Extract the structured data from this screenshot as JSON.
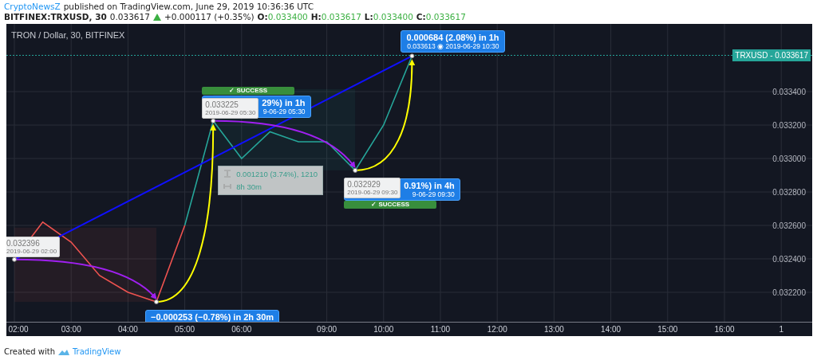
{
  "header": {
    "author": "CryptoNewsZ",
    "published": "published on TradingView.com, June 29, 2019 10:36:36 UTC",
    "symbol": "BITFINEX:TRXUSD, 30",
    "last": "0.033617",
    "change": "+0.000117 (+0.35%)",
    "ohlc": [
      {
        "label": "O:",
        "value": "0.033400"
      },
      {
        "label": "H:",
        "value": "0.033617"
      },
      {
        "label": "L:",
        "value": "0.033400"
      },
      {
        "label": "C:",
        "value": "0.033617"
      }
    ]
  },
  "chart": {
    "title": "TRON / Dollar, 30, BITFINEX",
    "price_label": "TRXUSD - 0.033617",
    "chart_data": {
      "type": "line",
      "categories": [
        "02:00",
        null,
        "03:00",
        null,
        "04:00",
        null,
        "05:00",
        null,
        "06:00",
        null,
        null,
        "09:00",
        null,
        "10:00",
        null,
        "11:00",
        null,
        "12:00",
        null,
        "13:00",
        null,
        "14:00",
        null,
        "15:00",
        null,
        "16:00",
        null,
        "1"
      ],
      "series": [
        {
          "color": "#ef5350",
          "values": [
            0.032396,
            0.03262,
            0.0325,
            0.0323,
            0.0322,
            0.032143,
            0.0326,
            null,
            null,
            null,
            null,
            null,
            null,
            null,
            null,
            null,
            null,
            null,
            null,
            null,
            null,
            null,
            null,
            null,
            null,
            null,
            null,
            null
          ]
        },
        {
          "color": "#26a69a",
          "values": [
            null,
            null,
            null,
            null,
            null,
            null,
            0.0326,
            0.033225,
            0.033,
            0.03316,
            0.0331,
            0.0331,
            0.032929,
            0.0332,
            0.033613,
            null,
            null,
            null,
            null,
            null,
            null,
            null,
            null,
            null,
            null,
            null,
            null,
            null
          ]
        }
      ],
      "ylim": [
        0.032019,
        0.033805
      ],
      "grid": true,
      "ref_lines": [
        {
          "axis": "y",
          "value": 0.033617,
          "color": "#26a69a"
        }
      ],
      "yticks": [
        {
          "value": 0.0334,
          "label": "0.033400"
        },
        {
          "value": 0.0332,
          "label": "0.033200"
        },
        {
          "value": 0.033,
          "label": "0.033000"
        },
        {
          "value": 0.0328,
          "label": "0.032800"
        },
        {
          "value": 0.0326,
          "label": "0.032600"
        },
        {
          "value": 0.0324,
          "label": "0.032400"
        },
        {
          "value": 0.0322,
          "label": "0.032200"
        }
      ]
    },
    "labels": [
      {
        "kind": "gain",
        "covered": false,
        "text": "0.000684 (2.08%) in 1h",
        "detail": "0.033613  ◉  2019-06-29  10:30"
      },
      {
        "kind": "success",
        "text": "✓ SUCCESS"
      },
      {
        "kind": "point",
        "text": "0.033225",
        "detail": "2019-06-29 05:30"
      },
      {
        "kind": "gain",
        "covered": true,
        "text": "29%) in 1h",
        "detail": "9-06-29  05:30"
      },
      {
        "kind": "measure",
        "text": "0.001210 (3.74%), 1210",
        "detail": "8h 30m"
      },
      {
        "kind": "point",
        "text": "0.032929",
        "detail": "2019-06-29 09:30"
      },
      {
        "kind": "gain",
        "covered": true,
        "text": "0.91%) in 4h",
        "detail": "9-06-29  09:30"
      },
      {
        "kind": "success",
        "text": "✓ SUCCESS"
      },
      {
        "kind": "point",
        "text": "0.032396",
        "detail": "2019-06-29 02:00"
      },
      {
        "kind": "gain",
        "covered": false,
        "text": "−0.000253 (−0.78%) in 2h 30m"
      }
    ]
  },
  "footer": {
    "text": "Created with",
    "brand": "TradingView"
  }
}
